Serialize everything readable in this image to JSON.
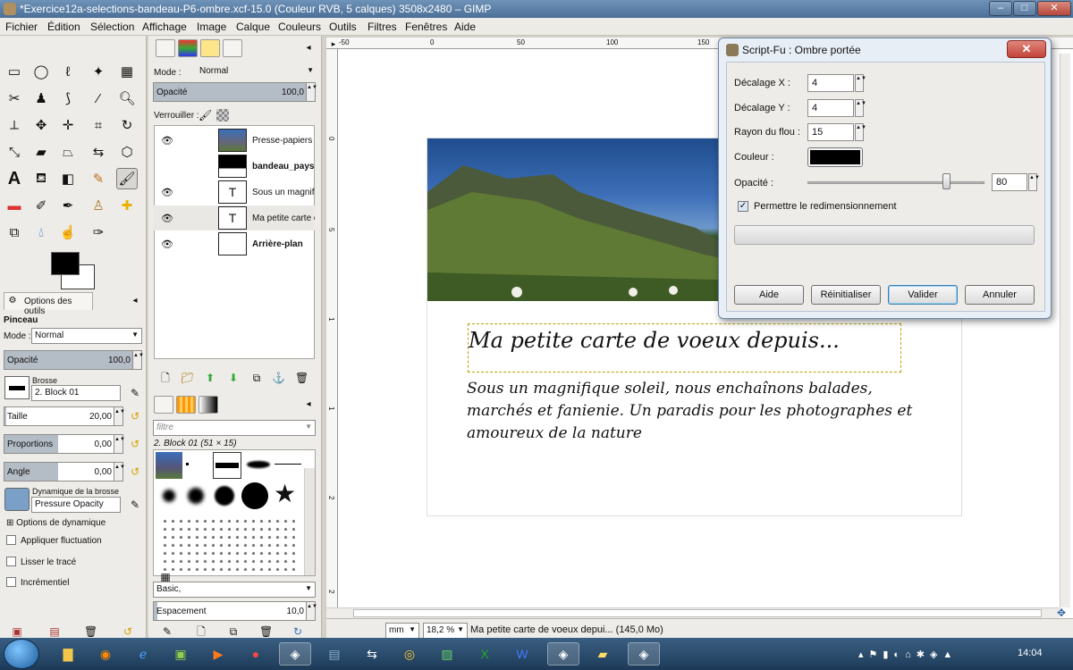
{
  "window": {
    "title": "*Exercice12a-selections-bandeau-P6-ombre.xcf-15.0 (Couleur RVB, 5 calques) 3508x2480 – GIMP",
    "minimize": "–",
    "maximize": "□",
    "close": "✕"
  },
  "menu": [
    "Fichier",
    "Édition",
    "Sélection",
    "Affichage",
    "Image",
    "Calque",
    "Couleurs",
    "Outils",
    "Filtres",
    "Fenêtres",
    "Aide"
  ],
  "layers_panel": {
    "mode_label": "Mode :",
    "mode_value": "Normal",
    "opacity_label": "Opacité",
    "opacity_value": "100,0",
    "opacity_fraction": 1.0,
    "lock_label": "Verrouiller :",
    "layers": [
      {
        "name": "Presse-papiers",
        "bold": false,
        "visible": true
      },
      {
        "name": "bandeau_paysag",
        "bold": true,
        "visible": false
      },
      {
        "name": "Sous un magnifi",
        "bold": false,
        "visible": true
      },
      {
        "name": "Ma petite carte d",
        "bold": false,
        "visible": true
      },
      {
        "name": "Arrière-plan",
        "bold": true,
        "visible": true
      }
    ]
  },
  "tool_options": {
    "tab_label": "Options des outils",
    "tool_name": "Pinceau",
    "mode_label": "Mode :",
    "mode_value": "Normal",
    "opacity_label": "Opacité",
    "opacity_value": "100,0",
    "brush_label": "Brosse",
    "brush_value": "2. Block 01",
    "size_label": "Taille",
    "size_value": "20,00",
    "ratio_label": "Proportions",
    "ratio_value": "0,00",
    "angle_label": "Angle",
    "angle_value": "0,00",
    "dynamics_label": "Dynamique de la brosse",
    "dynamics_value": "Pressure Opacity",
    "dynamics_options": "Options de dynamique",
    "jitter_label": "Appliquer fluctuation",
    "smooth_label": "Lisser le tracé",
    "incremental_label": "Incrémentiel"
  },
  "brushes_panel": {
    "filter_placeholder": "filtre",
    "brush_info": "2. Block 01 (51 × 15)",
    "preset": "Basic,",
    "spacing_label": "Espacement",
    "spacing_value": "10,0"
  },
  "rulers": {
    "h": [
      "-50",
      "0",
      "50",
      "100",
      "150"
    ],
    "v": [
      "0",
      "5",
      "1",
      "1",
      "2",
      "2"
    ]
  },
  "canvas": {
    "heading": "Ma petite carte de voeux depuis...",
    "body": "Sous un magnifique soleil, nous enchaînons balades, marchés et fanienie. Un paradis pour les photographes et amoureux de la nature"
  },
  "dialog": {
    "title": "Script-Fu : Ombre portée",
    "offset_x_label": "Décalage X :",
    "offset_x_value": "4",
    "offset_y_label": "Décalage Y :",
    "offset_y_value": "4",
    "blur_label": "Rayon du flou :",
    "blur_value": "15",
    "color_label": "Couleur :",
    "color_value": "#000000",
    "opacity_label": "Opacité :",
    "opacity_value": "80",
    "opacity_fraction": 0.8,
    "resize_label": "Permettre le redimensionnement",
    "resize_checked": true,
    "btn_help": "Aide",
    "btn_reset": "Réinitialiser",
    "btn_ok": "Valider",
    "btn_cancel": "Annuler"
  },
  "status": {
    "unit": "mm",
    "zoom": "18,2 %",
    "message": "Ma petite carte de voeux depui... (145,0 Mo)"
  },
  "taskbar": {
    "time": "14:04"
  }
}
